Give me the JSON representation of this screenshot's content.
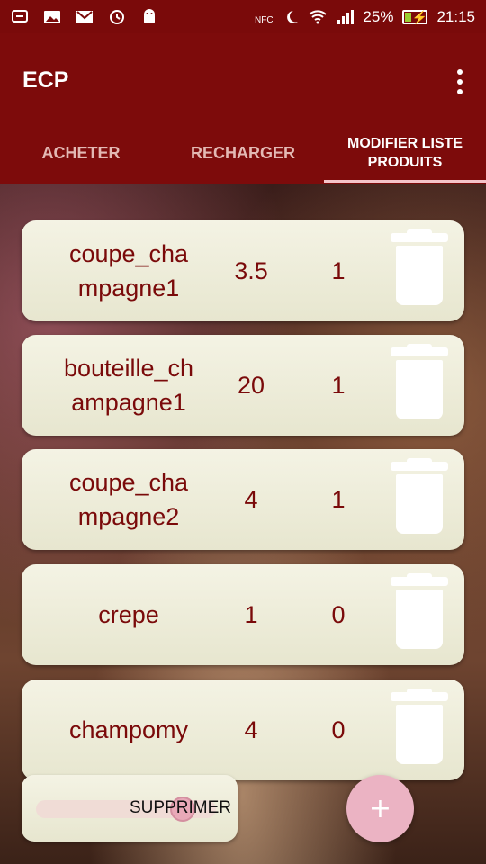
{
  "status_bar": {
    "battery": "25%",
    "time": "21:15",
    "icons_left": [
      "usb-icon",
      "image-icon",
      "gmail-icon",
      "sync-icon",
      "android-icon"
    ],
    "icons_right": [
      "nfc-icon",
      "moon-icon",
      "wifi-icon",
      "signal-icon",
      "battery-charging-icon"
    ]
  },
  "app": {
    "title": "ECP"
  },
  "tabs": [
    {
      "label": "ACHETER",
      "active": false
    },
    {
      "label": "RECHARGER",
      "active": false
    },
    {
      "label": "MODIFIER LISTE PRODUITS",
      "active": true
    }
  ],
  "products": [
    {
      "name": "coupe_cha mpagne1",
      "price": "3.5",
      "qty": "1"
    },
    {
      "name": "bouteille_ch ampagne1",
      "price": "20",
      "qty": "1"
    },
    {
      "name": "coupe_cha mpagne2",
      "price": "4",
      "qty": "1"
    },
    {
      "name": "crepe",
      "price": "1",
      "qty": "0"
    },
    {
      "name": "champomy",
      "price": "4",
      "qty": "0"
    }
  ],
  "bottom": {
    "delete_label": "SUPPRIMER",
    "add_label": "+"
  },
  "colors": {
    "primary": "#7d0b0b",
    "text_dark_red": "#7a0a0a",
    "card": "#f1f0de",
    "fab": "#ebb3c3"
  }
}
